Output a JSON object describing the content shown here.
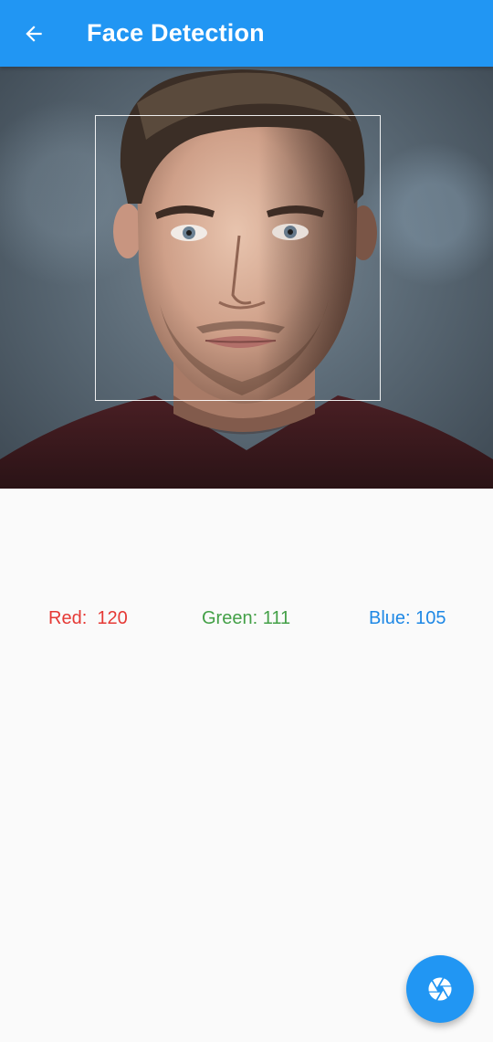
{
  "app_bar": {
    "title": "Face Detection",
    "back_icon": "arrow-back-icon",
    "color": "#2196f3"
  },
  "image": {
    "subject": "portrait photo of a man",
    "face_detected": true
  },
  "rgb": {
    "red_label": "Red:  120",
    "green_label": "Green: 111",
    "blue_label": "Blue: 105",
    "red_color": "#e53935",
    "green_color": "#43a047",
    "blue_color": "#1e88e5"
  },
  "fab": {
    "icon": "camera-shutter-icon",
    "color": "#2196f3"
  }
}
